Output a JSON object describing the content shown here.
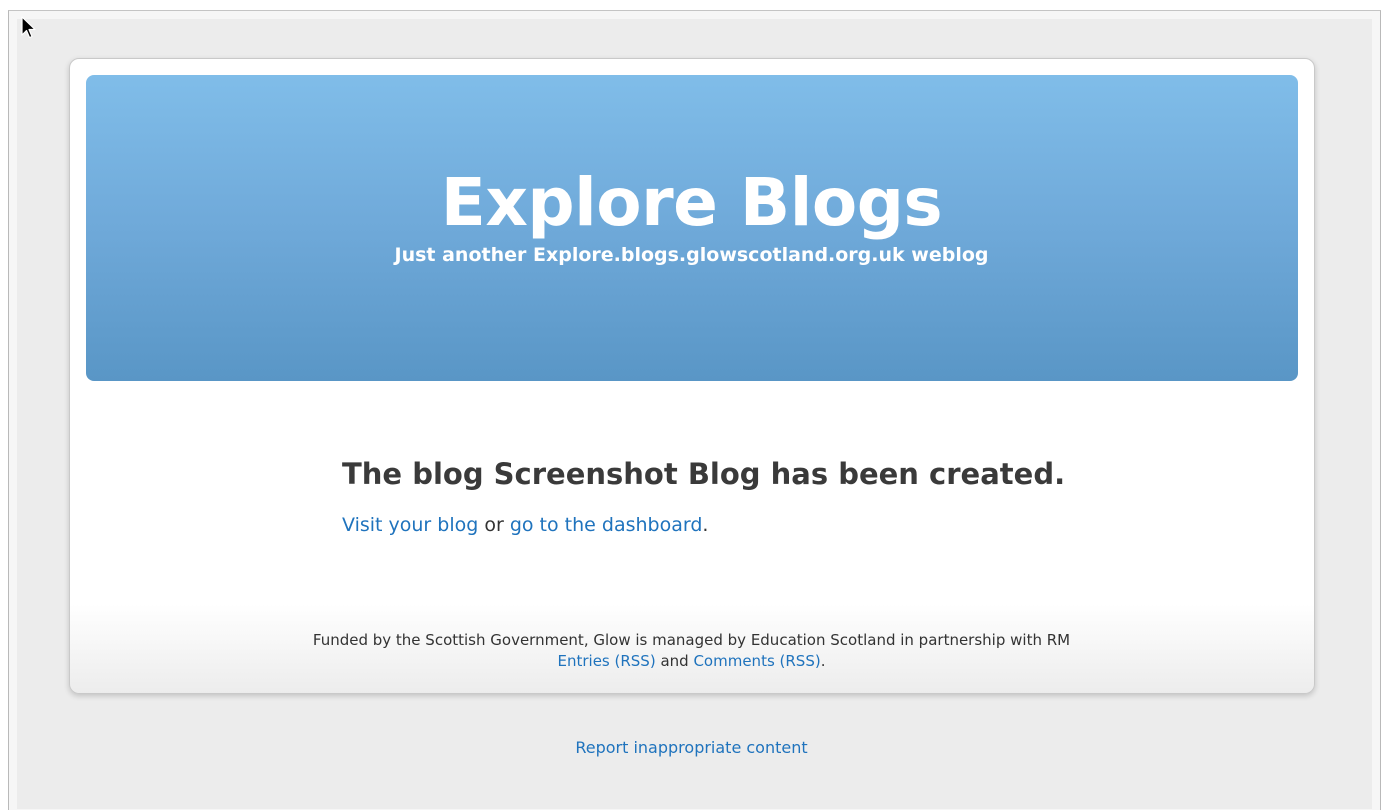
{
  "site": {
    "title": "Explore Blogs",
    "tagline": "Just another Explore.blogs.glowscotland.org.uk weblog"
  },
  "confirmation": {
    "heading": "The blog Screenshot Blog has been created.",
    "visit_link": "Visit your blog",
    "or_text": " or ",
    "dashboard_link": "go to the dashboard",
    "period": "."
  },
  "footer": {
    "credit": "Funded by the Scottish Government, Glow is managed by Education Scotland in partnership with RM",
    "entries_rss": "Entries (RSS)",
    "and_text": " and ",
    "comments_rss": "Comments (RSS)",
    "period": "."
  },
  "report_link": "Report inappropriate content",
  "colors": {
    "header_top": "#80bde9",
    "header_bottom": "#5996c6",
    "link": "#1f73bd",
    "heading_text": "#3a3a3a",
    "page_background": "#ececec"
  },
  "icons": {
    "cursor": "mouse-pointer-icon"
  }
}
